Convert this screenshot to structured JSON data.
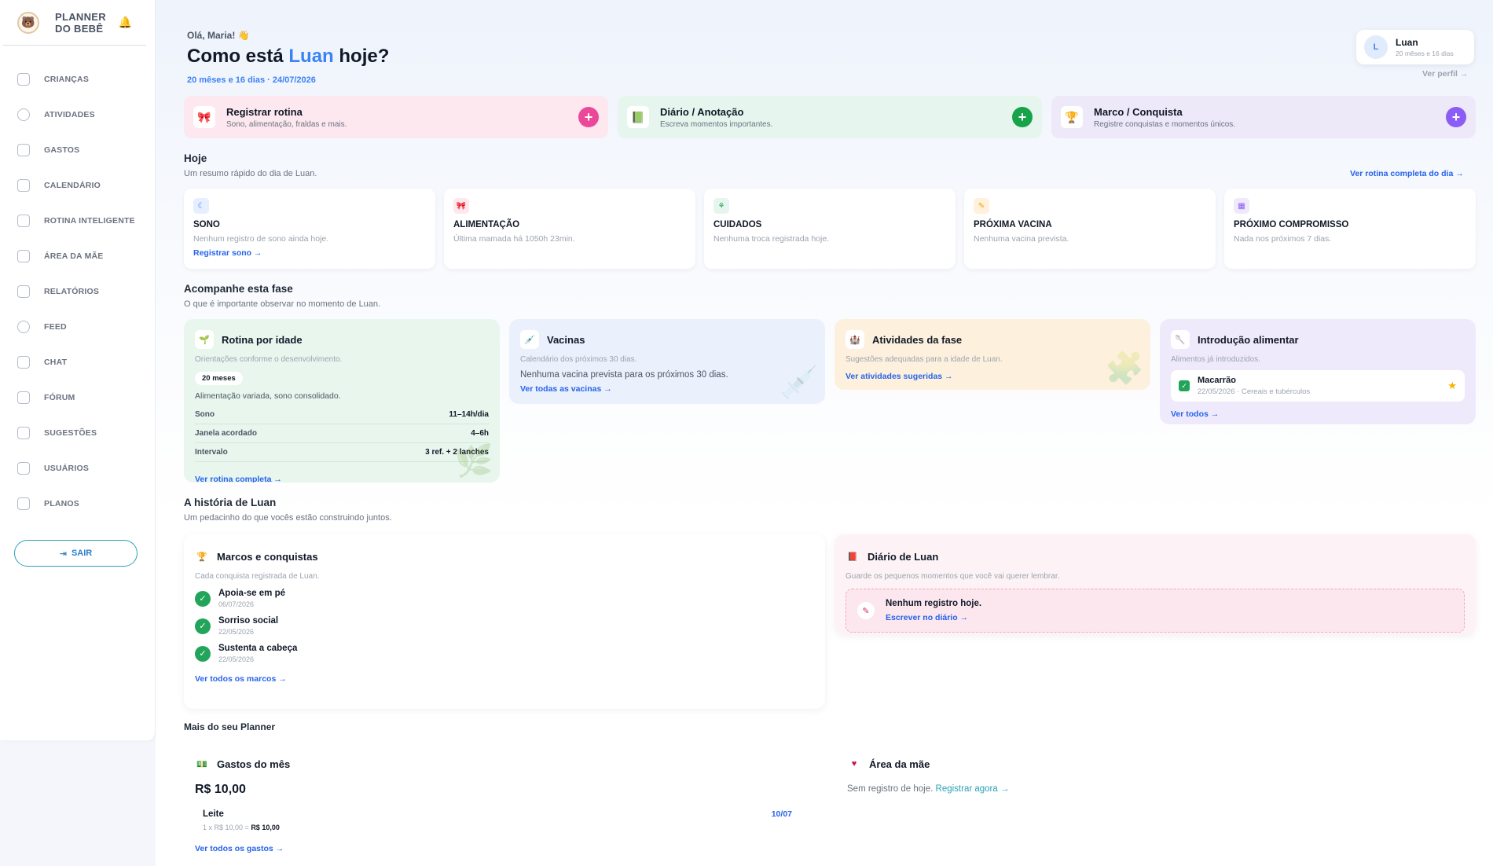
{
  "app": {
    "title_line1": "PLANNER",
    "title_line2": "DO BEBÊ"
  },
  "sidebar": {
    "items": [
      {
        "label": "CRIANÇAS",
        "icon": "children-icon"
      },
      {
        "label": "ATIVIDADES",
        "icon": "smile-icon"
      },
      {
        "label": "GASTOS",
        "icon": "cart-icon"
      },
      {
        "label": "CALENDÁRIO",
        "icon": "calendar-icon"
      },
      {
        "label": "ROTINA INTELIGENTE",
        "icon": "alarm-icon"
      },
      {
        "label": "ÁREA DA MÃE",
        "icon": "heart-icon"
      },
      {
        "label": "RELATÓRIOS",
        "icon": "report-icon"
      },
      {
        "label": "FEED",
        "icon": "globe-icon"
      },
      {
        "label": "CHAT",
        "icon": "send-icon"
      },
      {
        "label": "FÓRUM",
        "icon": "forum-icon"
      },
      {
        "label": "SUGESTÕES",
        "icon": "lightbulb-icon"
      },
      {
        "label": "USUÁRIOS",
        "icon": "user-icon"
      },
      {
        "label": "PLANOS",
        "icon": "card-icon"
      }
    ],
    "logout_label": "SAIR"
  },
  "header": {
    "greeting": "Olá, Maria! 👋",
    "title_prefix": "Como está",
    "child_name": "Luan",
    "title_suffix": "hoje?",
    "subtitle": "20 mêses e 16 dias · 24/07/2026",
    "profile": {
      "initial": "L",
      "name": "Luan",
      "age": "20 mêses e 16 dias",
      "link": "Ver perfil →"
    }
  },
  "quick_actions": [
    {
      "title": "Registrar rotina",
      "sub": "Sono, alimentação, fraldas e mais.",
      "icon": "🎀",
      "bg": "#fde8ef",
      "accent": "#ec4899"
    },
    {
      "title": "Diário / Anotação",
      "sub": "Escreva momentos importantes.",
      "icon": "📗",
      "bg": "#e6f6ee",
      "accent": "#16a34a"
    },
    {
      "title": "Marco / Conquista",
      "sub": "Registre conquistas e momentos únicos.",
      "icon": "🏆",
      "bg": "#ede9f9",
      "accent": "#8b5cf6"
    }
  ],
  "today": {
    "title": "Hoje",
    "sub": "Um resumo rápido do dia de Luan.",
    "link": "Ver rotina completa do dia →",
    "cards": [
      {
        "title": "SONO",
        "text": "Nenhum registro de sono ainda hoje.",
        "link": "Registrar sono →",
        "icon": "☾",
        "ibg": "#e6efff",
        "icolor": "#3b82f6"
      },
      {
        "title": "ALIMENTAÇÃO",
        "text": "Última mamada há 1050h 23min.",
        "link": "",
        "icon": "🎀",
        "ibg": "#fde8ef",
        "icolor": "#ec4899"
      },
      {
        "title": "CUIDADOS",
        "text": "Nenhuma troca registrada hoje.",
        "link": "",
        "icon": "⚘",
        "ibg": "#e6f6ee",
        "icolor": "#16a34a"
      },
      {
        "title": "PRÓXIMA VACINA",
        "text": "Nenhuma vacina prevista.",
        "link": "",
        "icon": "✎",
        "ibg": "#fff1dc",
        "icolor": "#f59e0b"
      },
      {
        "title": "PRÓXIMO COMPROMISSO",
        "text": "Nada nos próximos 7 dias.",
        "link": "",
        "icon": "▦",
        "ibg": "#efe9fb",
        "icolor": "#8b5cf6"
      }
    ]
  },
  "phase": {
    "title": "Acompanhe esta fase",
    "sub": "O que é importante observar no momento de Luan.",
    "routine": {
      "title": "Rotina por idade",
      "sub": "Orientações conforme o desenvolvimento.",
      "pill": "20 meses",
      "desc": "Alimentação variada, sono consolidado.",
      "rows": [
        {
          "k": "Sono",
          "v": "11–14h/dia"
        },
        {
          "k": "Janela acordado",
          "v": "4–6h"
        },
        {
          "k": "Intervalo",
          "v": "3 ref. + 2 lanches"
        }
      ],
      "link": "Ver rotina completa →"
    },
    "vaccines": {
      "title": "Vacinas",
      "sub": "Calendário dos próximos 30 dias.",
      "text": "Nenhuma vacina prevista para os próximos 30 dias.",
      "link": "Ver todas as vacinas →"
    },
    "activities": {
      "title": "Atividades da fase",
      "sub": "Sugestões adequadas para a idade de Luan.",
      "link": "Ver atividades sugeridas →"
    },
    "food": {
      "title": "Introdução alimentar",
      "sub": "Alimentos já introduzidos.",
      "item_name": "Macarrão",
      "item_meta": "22/05/2026 · Cereais e tubérculos",
      "link": "Ver todos →"
    }
  },
  "story": {
    "title": "A história de Luan",
    "sub": "Um pedacinho do que vocês estão construindo juntos.",
    "milestones": {
      "title": "Marcos e conquistas",
      "sub": "Cada conquista registrada de Luan.",
      "items": [
        {
          "name": "Apoia-se em pé",
          "date": "06/07/2026"
        },
        {
          "name": "Sorriso social",
          "date": "22/05/2026"
        },
        {
          "name": "Sustenta a cabeça",
          "date": "22/05/2026"
        }
      ],
      "link": "Ver todos os marcos →"
    },
    "diary": {
      "title": "Diário de Luan",
      "sub": "Guarde os pequenos momentos que você vai querer lembrar.",
      "empty_title": "Nenhum registro hoje.",
      "empty_link": "Escrever no diário →"
    }
  },
  "more": {
    "title": "Mais do seu Planner",
    "expenses": {
      "title": "Gastos do mês",
      "total": "R$ 10,00",
      "item_name": "Leite",
      "item_calc": "1 x R$ 10,00 =",
      "item_total": "R$ 10,00",
      "item_date": "10/07",
      "link": "Ver todos os gastos →"
    },
    "mother": {
      "title": "Área da mãe",
      "text": "Sem registro de hoje.",
      "link": "Registrar agora →"
    }
  }
}
